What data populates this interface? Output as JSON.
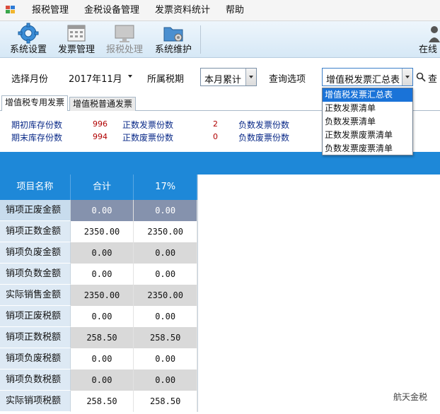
{
  "menu": {
    "items": [
      "报税管理",
      "金税设备管理",
      "发票资料统计",
      "帮助"
    ]
  },
  "toolbar": {
    "buttons": [
      {
        "label": "系统设置",
        "icon": "gear-icon"
      },
      {
        "label": "发票管理",
        "icon": "calendar-icon"
      },
      {
        "label": "报税处理",
        "icon": "monitor-icon",
        "disabled": true
      },
      {
        "label": "系统维护",
        "icon": "folder-gear-icon"
      }
    ],
    "online_label": "在线"
  },
  "filter": {
    "month_label": "选择月份",
    "month_value": "2017年11月",
    "period_label": "所属税期",
    "period_value": "本月累计",
    "query_label": "查询选项",
    "query_value": "增值税发票汇总表",
    "search_label": "查"
  },
  "dropdown": {
    "options": [
      "增值税发票汇总表",
      "正数发票清单",
      "负数发票清单",
      "正数发票废票清单",
      "负数发票废票清单"
    ],
    "selected_index": 0
  },
  "tabs": [
    "增值税专用发票",
    "增值税普通发票"
  ],
  "summary": {
    "row1": {
      "a_label": "期初库存份数",
      "a_value": "996",
      "b_label": "正数发票份数",
      "b_value": "2",
      "c_label": "负数发票份数"
    },
    "row2": {
      "a_label": "期末库存份数",
      "a_value": "994",
      "b_label": "正数废票份数",
      "b_value": "0",
      "c_label": "负数废票份数"
    }
  },
  "grid": {
    "columns": [
      "项目名称",
      "合计",
      "17%"
    ],
    "rows": [
      [
        "销项正废金额",
        "0.00",
        "0.00"
      ],
      [
        "销项正数金额",
        "2350.00",
        "2350.00"
      ],
      [
        "销项负废金额",
        "0.00",
        "0.00"
      ],
      [
        "销项负数金额",
        "0.00",
        "0.00"
      ],
      [
        "实际销售金额",
        "2350.00",
        "2350.00"
      ],
      [
        "销项正废税额",
        "0.00",
        "0.00"
      ],
      [
        "销项正数税额",
        "258.50",
        "258.50"
      ],
      [
        "销项负废税额",
        "0.00",
        "0.00"
      ],
      [
        "销项负数税额",
        "0.00",
        "0.00"
      ],
      [
        "实际销项税额",
        "258.50",
        "258.50"
      ]
    ],
    "selected_row": 0
  },
  "watermark": "航天金税",
  "colors": {
    "accent": "#1e88d8",
    "selection": "#1a73d8"
  }
}
